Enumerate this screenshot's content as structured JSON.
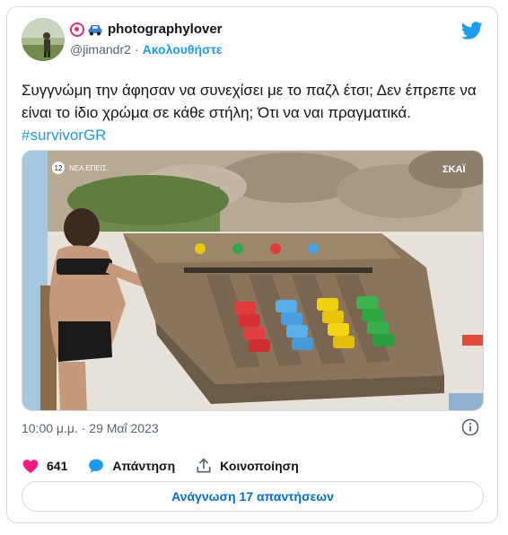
{
  "author": {
    "display_name": "photographylover",
    "handle": "@jimandr2",
    "separator": "·",
    "follow_label": "Ακολουθήστε"
  },
  "tweet": {
    "text": "Συγγνώμη την άφησαν να συνεχίσει με το παζλ έτσι; Δεν έπρεπε να είναι το ίδιο χρώμα σε κάθε στήλη; Ότι να ναι πραγματικά. ",
    "hashtag": "#survivorGR",
    "timestamp": "10:00 μ.μ. · 29 Μαΐ 2023"
  },
  "media": {
    "channel_logo": "ΣΚΑΪ",
    "badge": "12",
    "corner_text": "ΝΕΑ ΕΠΕΙΣ."
  },
  "actions": {
    "like_count": "641",
    "reply_label": "Απάντηση",
    "share_label": "Κοινοποίηση"
  },
  "read_replies_label": "Ανάγνωση 17 απαντήσεων",
  "colors": {
    "link": "#1d9bf0",
    "like": "#f91880",
    "reply": "#1d9bf0",
    "twitter": "#1d9bf0"
  },
  "icons": [
    "instagram-icon",
    "car-icon",
    "twitter-bird-icon",
    "info-icon",
    "heart-icon",
    "reply-bubble-icon",
    "share-icon"
  ]
}
